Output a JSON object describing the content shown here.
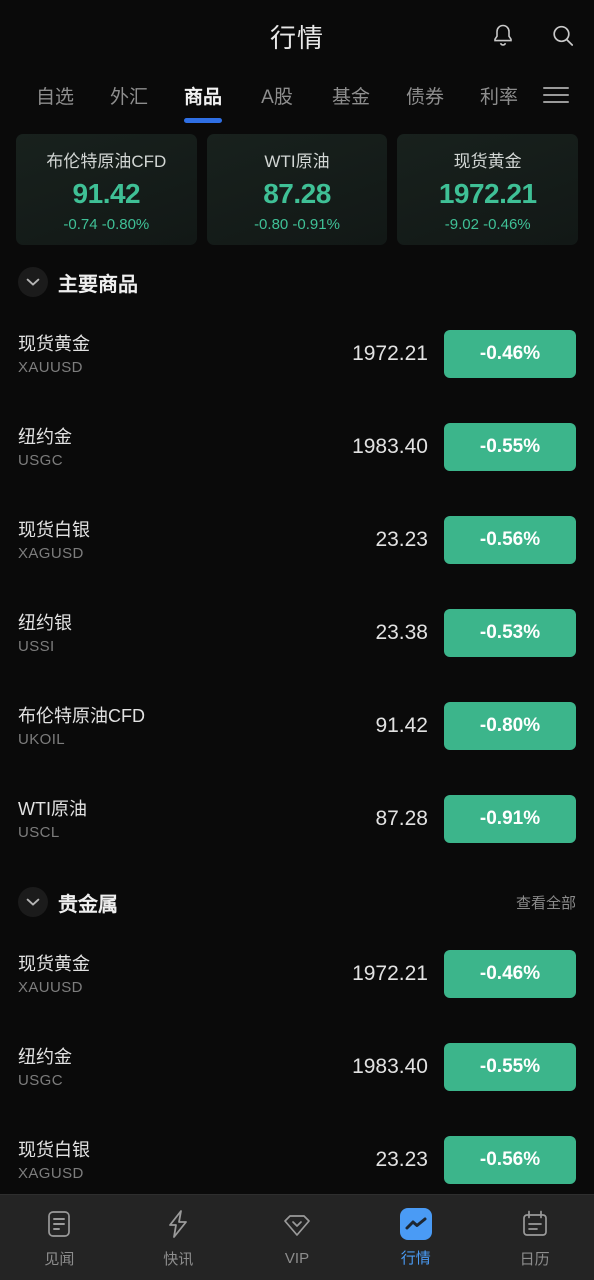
{
  "header": {
    "title": "行情",
    "icons": [
      {
        "name": "notification-bell-icon",
        "label": "通知"
      },
      {
        "name": "search-icon",
        "label": "搜索"
      }
    ]
  },
  "tabs": {
    "items": [
      {
        "label": "自选",
        "active": false
      },
      {
        "label": "外汇",
        "active": false
      },
      {
        "label": "商品",
        "active": true
      },
      {
        "label": "A股",
        "active": false
      },
      {
        "label": "基金",
        "active": false
      },
      {
        "label": "债券",
        "active": false
      },
      {
        "label": "利率",
        "active": false
      }
    ],
    "menu_icon": "hamburger-menu-icon",
    "active_indicator_color": "#2f6fe4"
  },
  "ticker_cards": [
    {
      "name": "布伦特原油CFD",
      "price": "91.42",
      "change": "-0.74 -0.80%",
      "direction": "down"
    },
    {
      "name": "WTI原油",
      "price": "87.28",
      "change": "-0.80 -0.91%",
      "direction": "down"
    },
    {
      "name": "现货黄金",
      "price": "1972.21",
      "change": "-9.02 -0.46%",
      "direction": "down"
    }
  ],
  "sections": [
    {
      "title": "主要商品",
      "see_all": "",
      "rows": [
        {
          "name": "现货黄金",
          "code": "XAUUSD",
          "price": "1972.21",
          "change_pct": "-0.46%",
          "direction": "down"
        },
        {
          "name": "纽约金",
          "code": "USGC",
          "price": "1983.40",
          "change_pct": "-0.55%",
          "direction": "down"
        },
        {
          "name": "现货白银",
          "code": "XAGUSD",
          "price": "23.23",
          "change_pct": "-0.56%",
          "direction": "down"
        },
        {
          "name": "纽约银",
          "code": "USSI",
          "price": "23.38",
          "change_pct": "-0.53%",
          "direction": "down"
        },
        {
          "name": "布伦特原油CFD",
          "code": "UKOIL",
          "price": "91.42",
          "change_pct": "-0.80%",
          "direction": "down"
        },
        {
          "name": "WTI原油",
          "code": "USCL",
          "price": "87.28",
          "change_pct": "-0.91%",
          "direction": "down"
        }
      ]
    },
    {
      "title": "贵金属",
      "see_all": "查看全部",
      "rows": [
        {
          "name": "现货黄金",
          "code": "XAUUSD",
          "price": "1972.21",
          "change_pct": "-0.46%",
          "direction": "down"
        },
        {
          "name": "纽约金",
          "code": "USGC",
          "price": "1983.40",
          "change_pct": "-0.55%",
          "direction": "down"
        },
        {
          "name": "现货白银",
          "code": "XAGUSD",
          "price": "23.23",
          "change_pct": "-0.56%",
          "direction": "down"
        }
      ]
    }
  ],
  "bottom_nav": [
    {
      "label": "见闻",
      "icon": "news-document-icon",
      "active": false
    },
    {
      "label": "快讯",
      "icon": "lightning-bolt-icon",
      "active": false
    },
    {
      "label": "VIP",
      "icon": "diamond-gem-icon",
      "active": false
    },
    {
      "label": "行情",
      "icon": "market-chart-icon",
      "active": true
    },
    {
      "label": "日历",
      "icon": "calendar-icon",
      "active": false
    }
  ],
  "colors": {
    "background": "#0a0a0a",
    "down_green": "#3cb58b",
    "accent_blue": "#4a9bf5",
    "tab_indicator": "#2f6fe4",
    "card_bg": "#151d1a"
  }
}
